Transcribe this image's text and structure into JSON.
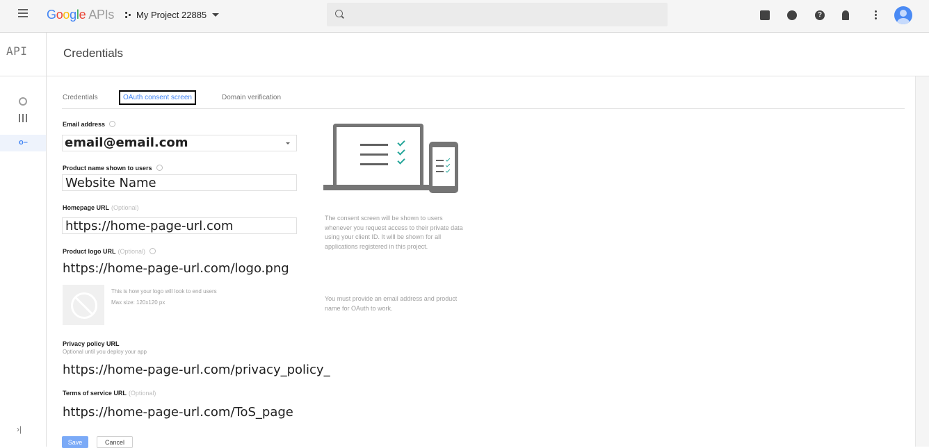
{
  "topbar": {
    "logo": "Google",
    "apis": "APIs",
    "project": "My Project 22885",
    "search_placeholder": ""
  },
  "rail": {
    "title": "API",
    "items": [
      {
        "name": "dashboard",
        "icon": "dashboard-icon"
      },
      {
        "name": "library",
        "icon": "library-icon"
      },
      {
        "name": "credentials",
        "icon": "key-icon"
      }
    ]
  },
  "page": {
    "title": "Credentials"
  },
  "tabs": [
    "Credentials",
    "OAuth consent screen",
    "Domain verification"
  ],
  "form": {
    "email": {
      "label": "Email address",
      "value": "email@email.com"
    },
    "product": {
      "label": "Product name shown to users",
      "value": "Website Name"
    },
    "homepage": {
      "label": "Homepage URL",
      "optional": "(Optional)",
      "value": "https://home-page-url.com"
    },
    "logo": {
      "label": "Product logo URL",
      "optional": "(Optional)",
      "value": "https://home-page-url.com/logo.png",
      "note1": "This is how your logo will look to end users",
      "note2": "Max size: 120x120 px"
    },
    "privacy": {
      "label": "Privacy policy URL",
      "sub": "Optional until you deploy your app",
      "value": "https://home-page-url.com/privacy_policy_"
    },
    "tos": {
      "label": "Terms of service URL",
      "optional": "(Optional)",
      "value": "https://home-page-url.com/ToS_page"
    }
  },
  "info": {
    "p1": "The consent screen will be shown to users whenever you request access to their private data using your client ID. It will be shown for all applications registered in this project.",
    "p2": "You must provide an email address and product name for OAuth to work."
  },
  "buttons": {
    "save": "Save",
    "cancel": "Cancel"
  },
  "colors": {
    "accent": "#4285f4",
    "check": "#26a69a"
  }
}
